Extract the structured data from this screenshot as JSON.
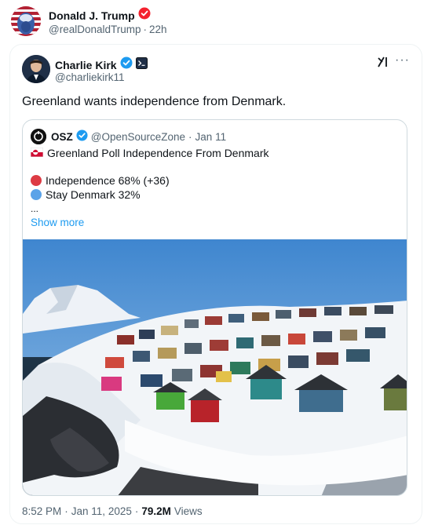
{
  "repost": {
    "name": "Donald J. Trump",
    "handle": "@realDonaldTrump",
    "separator": "·",
    "time": "22h"
  },
  "post": {
    "name": "Charlie Kirk",
    "handle": "@charliekirk11",
    "text": "Greenland wants independence from Denmark.",
    "more_icon": "···"
  },
  "quote": {
    "name": "OSZ",
    "handle": "@OpenSourceZone",
    "separator": "·",
    "date": "Jan 11",
    "flag_icon": "greenland-flag-icon",
    "title": "Greenland Poll Independence From Denmark",
    "options": [
      {
        "label": "Independence 68% (+36)",
        "color": "#dd3b44"
      },
      {
        "label": "Stay Denmark 32%",
        "color": "#5ba3e8"
      }
    ],
    "ellipsis": "...",
    "show_more": "Show more"
  },
  "meta": {
    "time": "8:52 PM",
    "separator1": "·",
    "date": "Jan 11, 2025",
    "separator2": "·",
    "views_count": "79.2M",
    "views_label": "Views"
  },
  "colors": {
    "verified_badge_red": "#f4212e",
    "verified_badge_blue": "#1d9bf0",
    "link_blue": "#1d9bf0",
    "secondary_text": "#536471"
  }
}
